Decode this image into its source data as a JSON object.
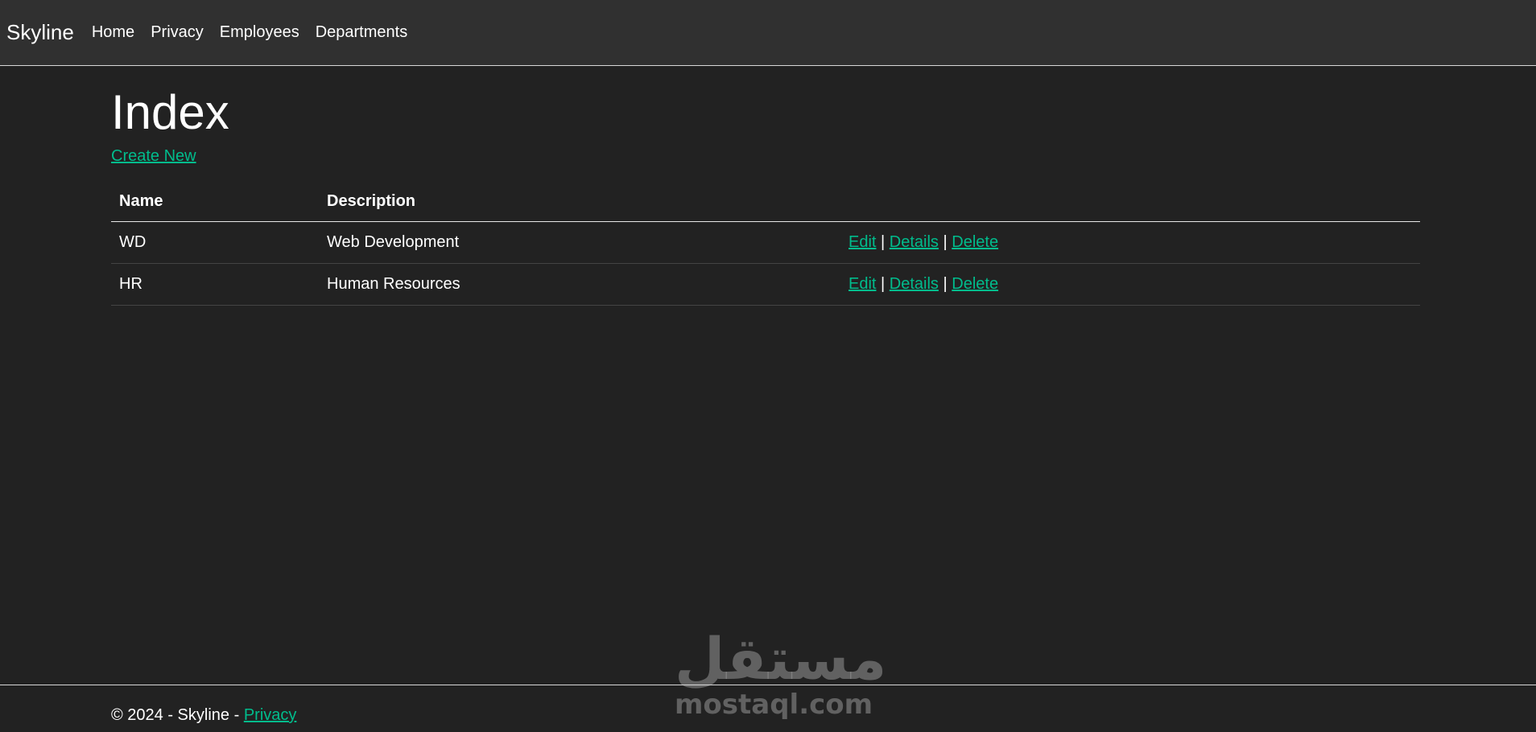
{
  "navbar": {
    "brand": "Skyline",
    "items": [
      {
        "label": "Home"
      },
      {
        "label": "Privacy"
      },
      {
        "label": "Employees"
      },
      {
        "label": "Departments"
      }
    ]
  },
  "main": {
    "title": "Index",
    "create_new": "Create New",
    "table": {
      "headers": [
        "Name",
        "Description"
      ],
      "rows": [
        {
          "name": "WD",
          "description": "Web Development",
          "edit": "Edit",
          "details": "Details",
          "delete": "Delete"
        },
        {
          "name": "HR",
          "description": "Human Resources",
          "edit": "Edit",
          "details": "Details",
          "delete": "Delete"
        }
      ],
      "separator": "|"
    }
  },
  "watermark": {
    "arabic": "مستقل",
    "latin": "mostaql.com"
  },
  "footer": {
    "text": "© 2024 - Skyline - ",
    "privacy_link": "Privacy"
  },
  "colors": {
    "background": "#222222",
    "navbar": "#303030",
    "link": "#00bc8c"
  }
}
